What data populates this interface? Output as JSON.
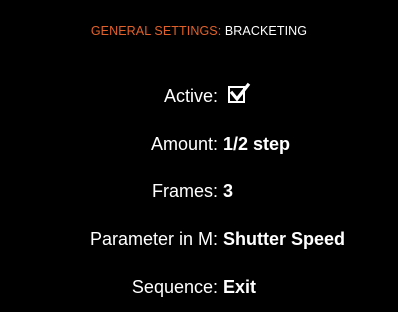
{
  "header": {
    "section": "GENERAL SETTINGS",
    "separator": ":",
    "page": " BRACKETING"
  },
  "settings": {
    "active": {
      "label": "Active:",
      "checked": true,
      "icon": "checkbox-checked-icon"
    },
    "amount": {
      "label": "Amount:",
      "value": "1/2 step"
    },
    "frames": {
      "label": "Frames:",
      "value": "3"
    },
    "parameter": {
      "label": "Parameter in M:",
      "value": "Shutter Speed"
    },
    "sequence": {
      "label": "Sequence:",
      "value": "Exit"
    }
  },
  "colors": {
    "accent": "#e0622a",
    "background": "#000000",
    "text": "#ffffff"
  }
}
